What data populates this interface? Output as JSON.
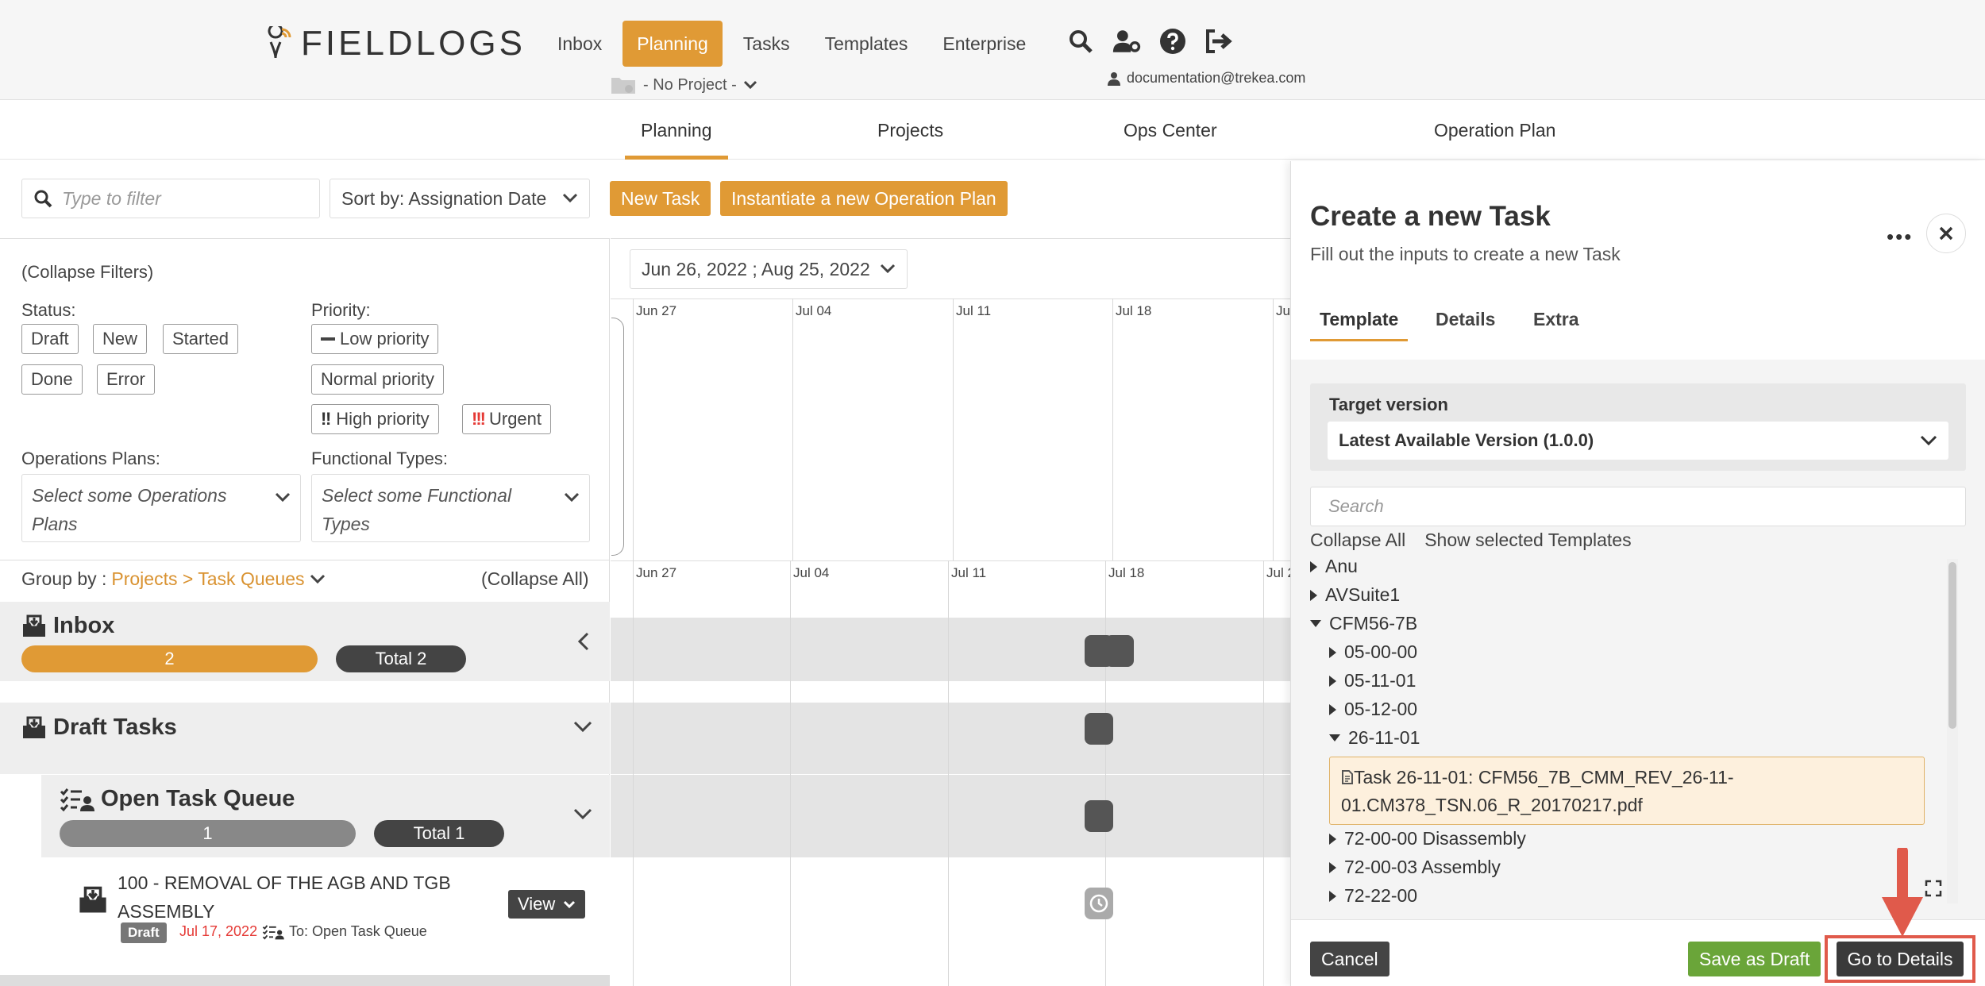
{
  "header": {
    "logo_text": "FIELDLOGS",
    "nav": [
      "Inbox",
      "Planning",
      "Tasks",
      "Templates",
      "Enterprise"
    ],
    "active_nav": "Planning",
    "project_selector": "- No Project -",
    "user_email": "documentation@trekea.com",
    "icons": [
      "search-icon",
      "user-settings-icon",
      "help-icon",
      "logout-icon"
    ]
  },
  "subnav": {
    "items": [
      "Planning",
      "Projects",
      "Ops Center",
      "Operation Plan"
    ],
    "active": "Planning"
  },
  "toolbar": {
    "filter_placeholder": "Type to filter",
    "sort_label": "Sort by: Assignation Date",
    "new_task": "New Task",
    "instantiate": "Instantiate a new Operation Plan"
  },
  "filters": {
    "collapse_label": "(Collapse Filters)",
    "status_label": "Status:",
    "status_chips": [
      "Draft",
      "New",
      "Started",
      "Done",
      "Error"
    ],
    "priority_label": "Priority:",
    "priority_chips": [
      "Low priority",
      "Normal priority",
      "High priority",
      "Urgent"
    ],
    "ops_plans_label": "Operations Plans:",
    "ops_plans_placeholder_1": "Select some Operations",
    "ops_plans_placeholder_2": "Plans",
    "functional_types_label": "Functional Types:",
    "functional_types_placeholder_1": "Select some Functional",
    "functional_types_placeholder_2": "Types"
  },
  "grouping": {
    "label": "Group by :",
    "value": "Projects > Task Queues",
    "collapse_all": "(Collapse All)"
  },
  "queues": {
    "inbox": {
      "title": "Inbox",
      "count": "2",
      "total": "Total 2"
    },
    "draft": {
      "title": "Draft Tasks"
    },
    "open": {
      "title": "Open Task Queue",
      "count": "1",
      "total": "Total 1"
    }
  },
  "task": {
    "title_line1": "100 - REMOVAL OF THE AGB AND TGB",
    "title_line2": "ASSEMBLY",
    "status": "Draft",
    "date": "Jul 17, 2022",
    "to": "To: Open Task Queue",
    "view_label": "View"
  },
  "gantt": {
    "date_range": "Jun 26, 2022 ; Aug 25, 2022",
    "ticks_top": [
      "Jun 27",
      "Jul 04",
      "Jul 11",
      "Jul 18",
      "Ju"
    ],
    "ticks_bottom": [
      "Jun 27",
      "Jul 04",
      "Jul 11",
      "Jul 18",
      "Jul 2"
    ]
  },
  "drawer": {
    "title": "Create a new Task",
    "subtitle": "Fill out the inputs to create a new Task",
    "tabs": [
      "Template",
      "Details",
      "Extra"
    ],
    "active_tab": "Template",
    "target_label": "Target version",
    "target_value": "Latest Available Version (1.0.0)",
    "search_placeholder": "Search",
    "collapse_all": "Collapse All",
    "show_selected": "Show selected Templates",
    "tree": [
      {
        "label": "Anu",
        "level": 0,
        "expanded": false
      },
      {
        "label": "AVSuite1",
        "level": 0,
        "expanded": false
      },
      {
        "label": "CFM56-7B",
        "level": 0,
        "expanded": true
      },
      {
        "label": "05-00-00",
        "level": 1,
        "expanded": false
      },
      {
        "label": "05-11-01",
        "level": 1,
        "expanded": false
      },
      {
        "label": "05-12-00",
        "level": 1,
        "expanded": false
      },
      {
        "label": "26-11-01",
        "level": 1,
        "expanded": true
      },
      {
        "label": "72-00-00 Disassembly",
        "level": 1,
        "expanded": false
      },
      {
        "label": "72-00-03 Assembly",
        "level": 1,
        "expanded": false
      },
      {
        "label": "72-22-00",
        "level": 1,
        "expanded": false
      }
    ],
    "selected_task_line1": "Task 26-11-01: CFM56_7B_CMM_REV_26-11-",
    "selected_task_line2": "01.CM378_TSN.06_R_20170217.pdf",
    "cancel": "Cancel",
    "save_draft": "Save as Draft",
    "go_details": "Go to Details"
  },
  "colors": {
    "accent": "#e09a35",
    "green": "#6aa539",
    "dark": "#444444",
    "highlight": "#e05a4b"
  }
}
